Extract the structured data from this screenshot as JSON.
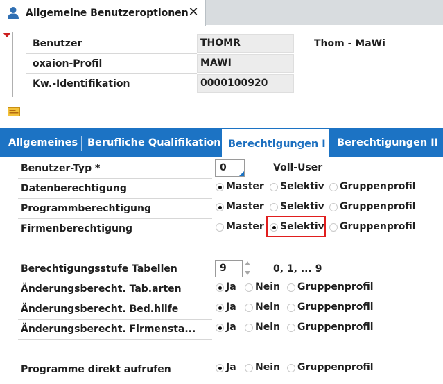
{
  "window_tab": {
    "title": "Allgemeine Benutzeroptionen",
    "close_symbol": "✕"
  },
  "header": {
    "fields": [
      {
        "label": "Benutzer",
        "value": "THOMR"
      },
      {
        "label": "oxaion-Profil",
        "value": "MAWI"
      },
      {
        "label": "Kw.-Identifikation",
        "value": "0000100920"
      }
    ],
    "user_description": "Thom - MaWi"
  },
  "tabs": [
    {
      "label": "Allgemeines",
      "active": false
    },
    {
      "label": "Berufliche Qualifikation",
      "active": false
    },
    {
      "label": "Berechtigungen I",
      "active": true
    },
    {
      "label": "Berechtigungen II",
      "active": false
    }
  ],
  "form": {
    "benutzer_typ": {
      "label": "Benutzer-Typ *",
      "value": "0",
      "description": "Voll-User"
    },
    "datenberechtigung": {
      "label": "Datenberechtigung",
      "options": [
        "Master",
        "Selektiv",
        "Gruppenprofil"
      ],
      "selected": "Master"
    },
    "programmberechtigung": {
      "label": "Programmberechtigung",
      "options": [
        "Master",
        "Selektiv",
        "Gruppenprofil"
      ],
      "selected": "Master"
    },
    "firmenberechtigung": {
      "label": "Firmenberechtigung",
      "options": [
        "Master",
        "Selektiv",
        "Gruppenprofil"
      ],
      "selected": "Selektiv"
    },
    "berechtigungsstufe": {
      "label": "Berechtigungsstufe Tabellen",
      "value": "9",
      "hint": "0, 1, ... 9"
    },
    "aend_tab_arten": {
      "label": "Änderungsberecht. Tab.arten",
      "options": [
        "Ja",
        "Nein",
        "Gruppenprofil"
      ],
      "selected": "Ja"
    },
    "aend_bed_hilfe": {
      "label": "Änderungsberecht. Bed.hilfe",
      "options": [
        "Ja",
        "Nein",
        "Gruppenprofil"
      ],
      "selected": "Ja"
    },
    "aend_firmensta": {
      "label": "Änderungsberecht. Firmensta...",
      "options": [
        "Ja",
        "Nein",
        "Gruppenprofil"
      ],
      "selected": "Ja"
    },
    "programme_direkt": {
      "label": "Programme direkt aufrufen",
      "options": [
        "Ja",
        "Nein",
        "Gruppenprofil"
      ],
      "selected": "Ja"
    }
  },
  "colors": {
    "tab_bar": "#1c73c4",
    "highlight": "#e01e1e",
    "collapse_arrow": "#cc1f1f"
  },
  "icons": [
    "user-icon",
    "close-icon",
    "collapse-arrow-icon",
    "note-icon",
    "spinner-icon"
  ]
}
